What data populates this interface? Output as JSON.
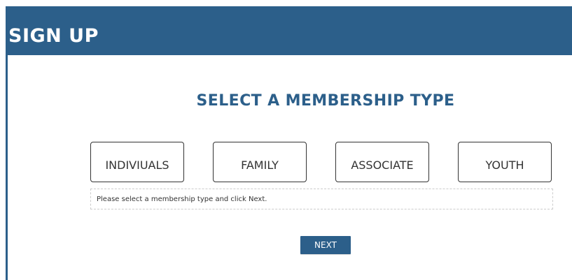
{
  "header": {
    "title": "SIGN UP"
  },
  "main": {
    "section_title": "SELECT A MEMBERSHIP TYPE",
    "membership_options": [
      {
        "label": "INDIVIUALS"
      },
      {
        "label": "FAMILY"
      },
      {
        "label": "ASSOCIATE"
      },
      {
        "label": "YOUTH"
      }
    ],
    "message": "Please select a membership type and click Next.",
    "next_label": "NEXT"
  },
  "colors": {
    "brand": "#2c5f8a",
    "border": "#333333",
    "dashed_border": "#cccccc",
    "background": "#ffffff"
  }
}
